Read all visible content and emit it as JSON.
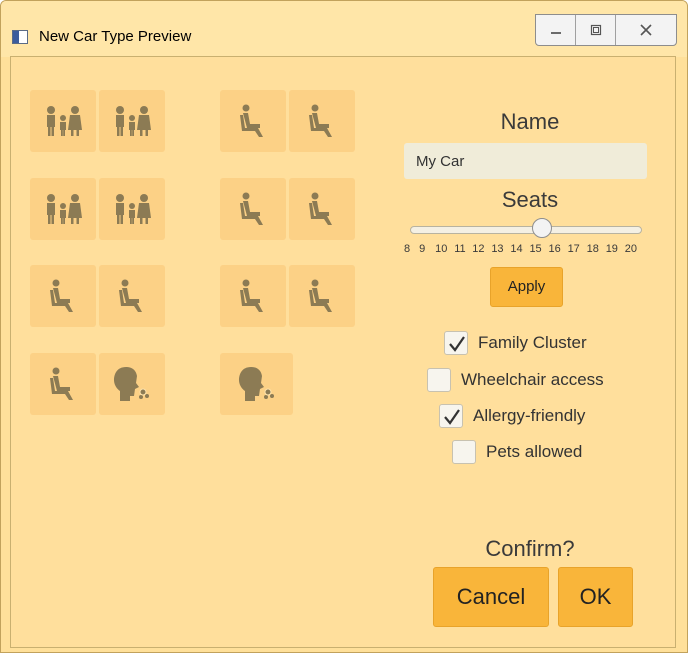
{
  "window": {
    "title": "New Car Type Preview"
  },
  "form": {
    "name_label": "Name",
    "name_value": "My Car",
    "seats_label": "Seats",
    "seats_slider": {
      "min": 8,
      "max": 20,
      "value": 15,
      "tick_labels": [
        "8",
        "9",
        "10",
        "11",
        "12",
        "13",
        "14",
        "15",
        "16",
        "17",
        "18",
        "19",
        "20"
      ]
    },
    "apply_label": "Apply",
    "options": [
      {
        "label": "Family Cluster",
        "checked": true
      },
      {
        "label": "Wheelchair access",
        "checked": false
      },
      {
        "label": "Allergy-friendly",
        "checked": true
      },
      {
        "label": "Pets allowed",
        "checked": false
      }
    ],
    "confirm_label": "Confirm?",
    "cancel_label": "Cancel",
    "ok_label": "OK"
  },
  "seat_layout": {
    "rows": [
      [
        "family",
        "family",
        "wheelchair",
        "wheelchair"
      ],
      [
        "family",
        "family",
        "wheelchair",
        "wheelchair"
      ],
      [
        "wheelchair",
        "wheelchair",
        "wheelchair",
        "wheelchair"
      ],
      [
        "wheelchair",
        "allergy",
        "allergy"
      ]
    ]
  },
  "colors": {
    "background": "#ffdf9c",
    "seat": "#fcd186",
    "icon": "#8c7b54",
    "button": "#f9b53a"
  }
}
